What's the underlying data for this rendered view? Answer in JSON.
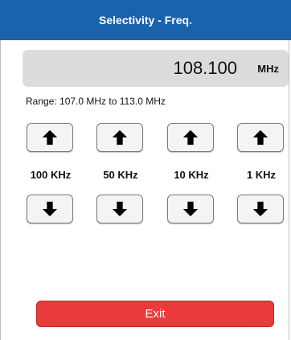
{
  "window": {
    "title": "Selectivity - Freq."
  },
  "frequency": {
    "value": "108.100",
    "unit": "MHz"
  },
  "range_text": "Range: 107.0 MHz to 113.0 MHz",
  "steps": [
    {
      "label": "100 KHz",
      "up_icon": "arrow-up-icon",
      "down_icon": "arrow-down-icon"
    },
    {
      "label": "50 KHz",
      "up_icon": "arrow-up-icon",
      "down_icon": "arrow-down-icon"
    },
    {
      "label": "10 KHz",
      "up_icon": "arrow-up-icon",
      "down_icon": "arrow-down-icon"
    },
    {
      "label": "1 KHz",
      "up_icon": "arrow-up-icon",
      "down_icon": "arrow-down-icon"
    }
  ],
  "exit_label": "Exit",
  "colors": {
    "titlebar": "#1b62ad",
    "exit_button": "#ea3b3b",
    "freq_box": "#dcdcdc"
  }
}
